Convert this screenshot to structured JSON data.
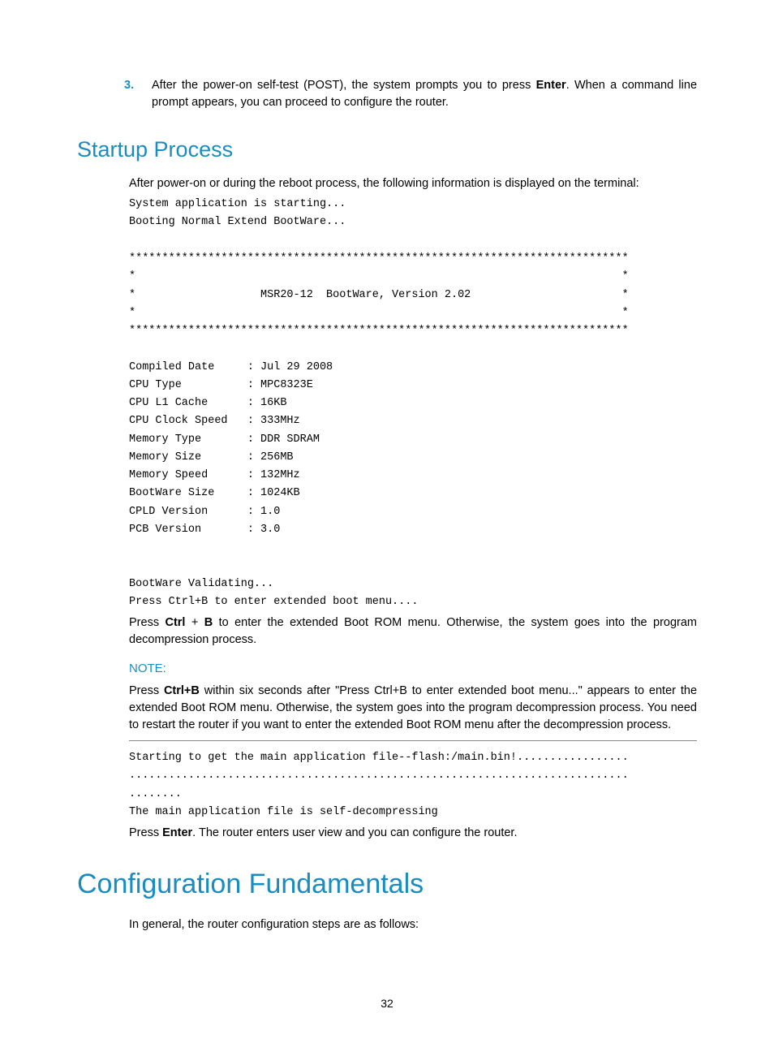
{
  "step3": {
    "num": "3.",
    "text_a": "After the power-on self-test (POST), the system prompts you to press ",
    "enter": "Enter",
    "text_b": ". When a command line prompt appears, you can proceed to configure the router."
  },
  "h2_startup": "Startup Process",
  "startup_intro": "After power-on or during the reboot process, the following information is displayed on the terminal:",
  "code1": "System application is starting...\nBooting Normal Extend BootWare...\n\n****************************************************************************\n*                                                                          *\n*                   MSR20-12  BootWare, Version 2.02                       *\n*                                                                          *\n****************************************************************************\n\nCompiled Date     : Jul 29 2008\nCPU Type          : MPC8323E\nCPU L1 Cache      : 16KB\nCPU Clock Speed   : 333MHz\nMemory Type       : DDR SDRAM\nMemory Size       : 256MB\nMemory Speed      : 132MHz\nBootWare Size     : 1024KB\nCPLD Version      : 1.0\nPCB Version       : 3.0\n\n\nBootWare Validating...\nPress Ctrl+B to enter extended boot menu....",
  "press_ctrl": {
    "a": "Press ",
    "ctrl": "Ctrl",
    "plus": " + ",
    "b": "B",
    "rest": " to enter the extended Boot ROM menu. Otherwise, the system goes into the program decompression process."
  },
  "note_label": "NOTE:",
  "note_body": {
    "a": "Press ",
    "ctrlb": "Ctrl+B",
    "rest": " within six seconds after \"Press Ctrl+B to enter extended boot menu...\" appears to enter the extended Boot ROM menu. Otherwise, the system goes into the program decompression process. You need to restart the router if you want to enter the extended Boot ROM menu after the decompression process."
  },
  "code2": "Starting to get the main application file--flash:/main.bin!.................\n............................................................................\n........\nThe main application file is self-decompressing",
  "press_enter": {
    "a": "Press ",
    "enter": "Enter",
    "rest": ". The router enters user view and you can configure the router."
  },
  "h1_config": "Configuration Fundamentals",
  "config_intro": "In general, the router configuration steps are as follows:",
  "page_num": "32"
}
